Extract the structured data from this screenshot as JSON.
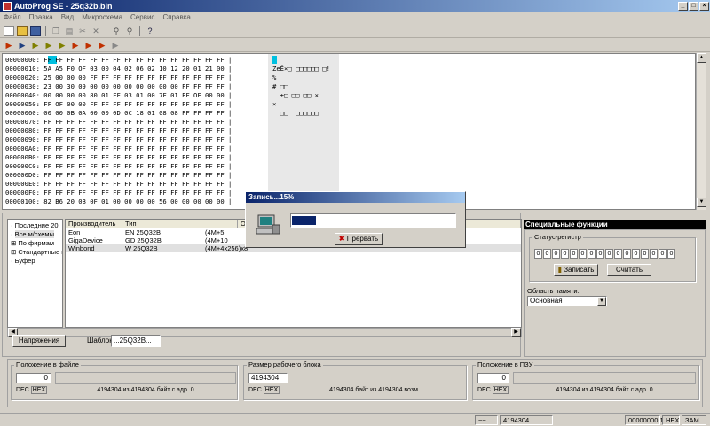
{
  "window": {
    "title": "AutoProg SE - 25q32b.bin"
  },
  "window_buttons": [
    "_",
    "□",
    "×"
  ],
  "menu": [
    "Файл",
    "Правка",
    "Вид",
    "Микросхема",
    "Сервис",
    "Справка"
  ],
  "toolbar1": [
    "new-icon",
    "open-icon",
    "save-icon",
    "copy-icon",
    "paste-icon",
    "cut-icon",
    "delete-icon",
    "find-icon",
    "find-next-icon",
    "about-icon"
  ],
  "toolbar2": [
    "chip-read-icon",
    "chip-write-icon",
    "chip-verify-icon",
    "chip-erase-icon",
    "chip-blank-icon",
    "chip-auto-icon",
    "chip-id-icon",
    "chip-protect-icon",
    "chip-stop-icon"
  ],
  "hex": {
    "lines": [
      "00000000: FF FF FF FF FF FF FF FF FF FF FF FF FF FF FF FF |",
      "00000010: 5A A5 F0 OF 03 00 04 02 06 02 10 12 20 01 21 00 |",
      "00000020: 25 00 00 00 FF FF FF FF FF FF FF FF FF FF FF FF |",
      "00000030: 23 00 30 09 00 00 00 00 00 00 00 00 FF FF FF FF |",
      "00000040: 00 00 00 00 80 01 FF 03 01 00 7F 01 FF OF 00 00 |",
      "00000050: FF OF 00 00 FF FF FF FF FF FF FF FF FF FF FF FF |",
      "00000060: 00 00 0B 0A 00 00 0D 0C 18 01 08 08 FF FF FF FF |",
      "00000070: FF FF FF FF FF FF FF FF FF FF FF FF FF FF FF FF |",
      "00000080: FF FF FF FF FF FF FF FF FF FF FF FF FF FF FF FF |",
      "00000090: FF FF FF FF FF FF FF FF FF FF FF FF FF FF FF FF |",
      "000000A0: FF FF FF FF FF FF FF FF FF FF FF FF FF FF FF FF |",
      "000000B0: FF FF FF FF FF FF FF FF FF FF FF FF FF FF FF FF |",
      "000000C0: FF FF FF FF FF FF FF FF FF FF FF FF FF FF FF FF |",
      "000000D0: FF FF FF FF FF FF FF FF FF FF FF FF FF FF FF FF |",
      "000000E0: FF FF FF FF FF FF FF FF FF FF FF FF FF FF FF FF |",
      "000000F0: FF FF FF FF FF FF FF FF FF FF FF FF FF FF FF FF |",
      "00000100: 82 B6 20 0B 0F 01 00 00 00 00 56 00 00 00 00 00 |"
    ],
    "ascii": [
      " ",
      "ZeЁ×□ □□□□□□ □!",
      "%",
      "# □□",
      "  ±□ □□ □□ ×",
      "×",
      "  □□  □□□□□□",
      "",
      "",
      "",
      "",
      "",
      "",
      "",
      "",
      "",
      ""
    ]
  },
  "tree": {
    "items": [
      "Последние 20",
      "Все м/схемы",
      "По фирмам",
      "Стандартные м",
      "Буфер"
    ]
  },
  "table": {
    "headers": [
      "Производитель",
      "Тип",
      "О"
    ],
    "rows": [
      {
        "maker": "Eon",
        "type": "EN 25Q32B",
        "size": "(4M+5"
      },
      {
        "maker": "GigaDevice",
        "type": "GD 25Q32B",
        "size": "(4M+10"
      },
      {
        "maker": "Winbond",
        "type": "W 25Q32B",
        "size": "(4M+4x256)x8"
      }
    ]
  },
  "voltage_button": "Напряжения",
  "template": {
    "label": "Шаблон",
    "value": "...25Q32B..."
  },
  "special": {
    "title": "Специальные функции",
    "status_label": "Статус-регистр",
    "bits": [
      "0",
      "0",
      "0",
      "0",
      "0",
      "0",
      "0",
      "0",
      "0",
      "0",
      "0",
      "0",
      "0",
      "0",
      "0",
      "0"
    ],
    "write_button": "Записать",
    "read_button": "Считать",
    "mem_area_label": "Область памяти:",
    "mem_area_value": "Основная"
  },
  "file_pos": {
    "label": "Положение в файле",
    "value": "0",
    "dec": "DEC",
    "hex": "HEX",
    "info": "4194304 из 4194304 байт с адр. 0"
  },
  "block": {
    "label": "Размер рабочего блока",
    "value": "4194304",
    "dec": "DEC",
    "hex": "HEX",
    "info": "4194304 байт из 4194304 возм."
  },
  "rom_pos": {
    "label": "Положение в ПЗУ",
    "value": "0",
    "dec": "DEC",
    "hex": "HEX",
    "info": "4194304 из 4194304 байт с адр. 0"
  },
  "status": {
    "size": "4194304",
    "address": "00000000:1",
    "mode": "HEX",
    "ins": "ЗАМ"
  },
  "dialog": {
    "title": "Запись...15%",
    "progress": 0.15,
    "cancel": "Прервать"
  }
}
